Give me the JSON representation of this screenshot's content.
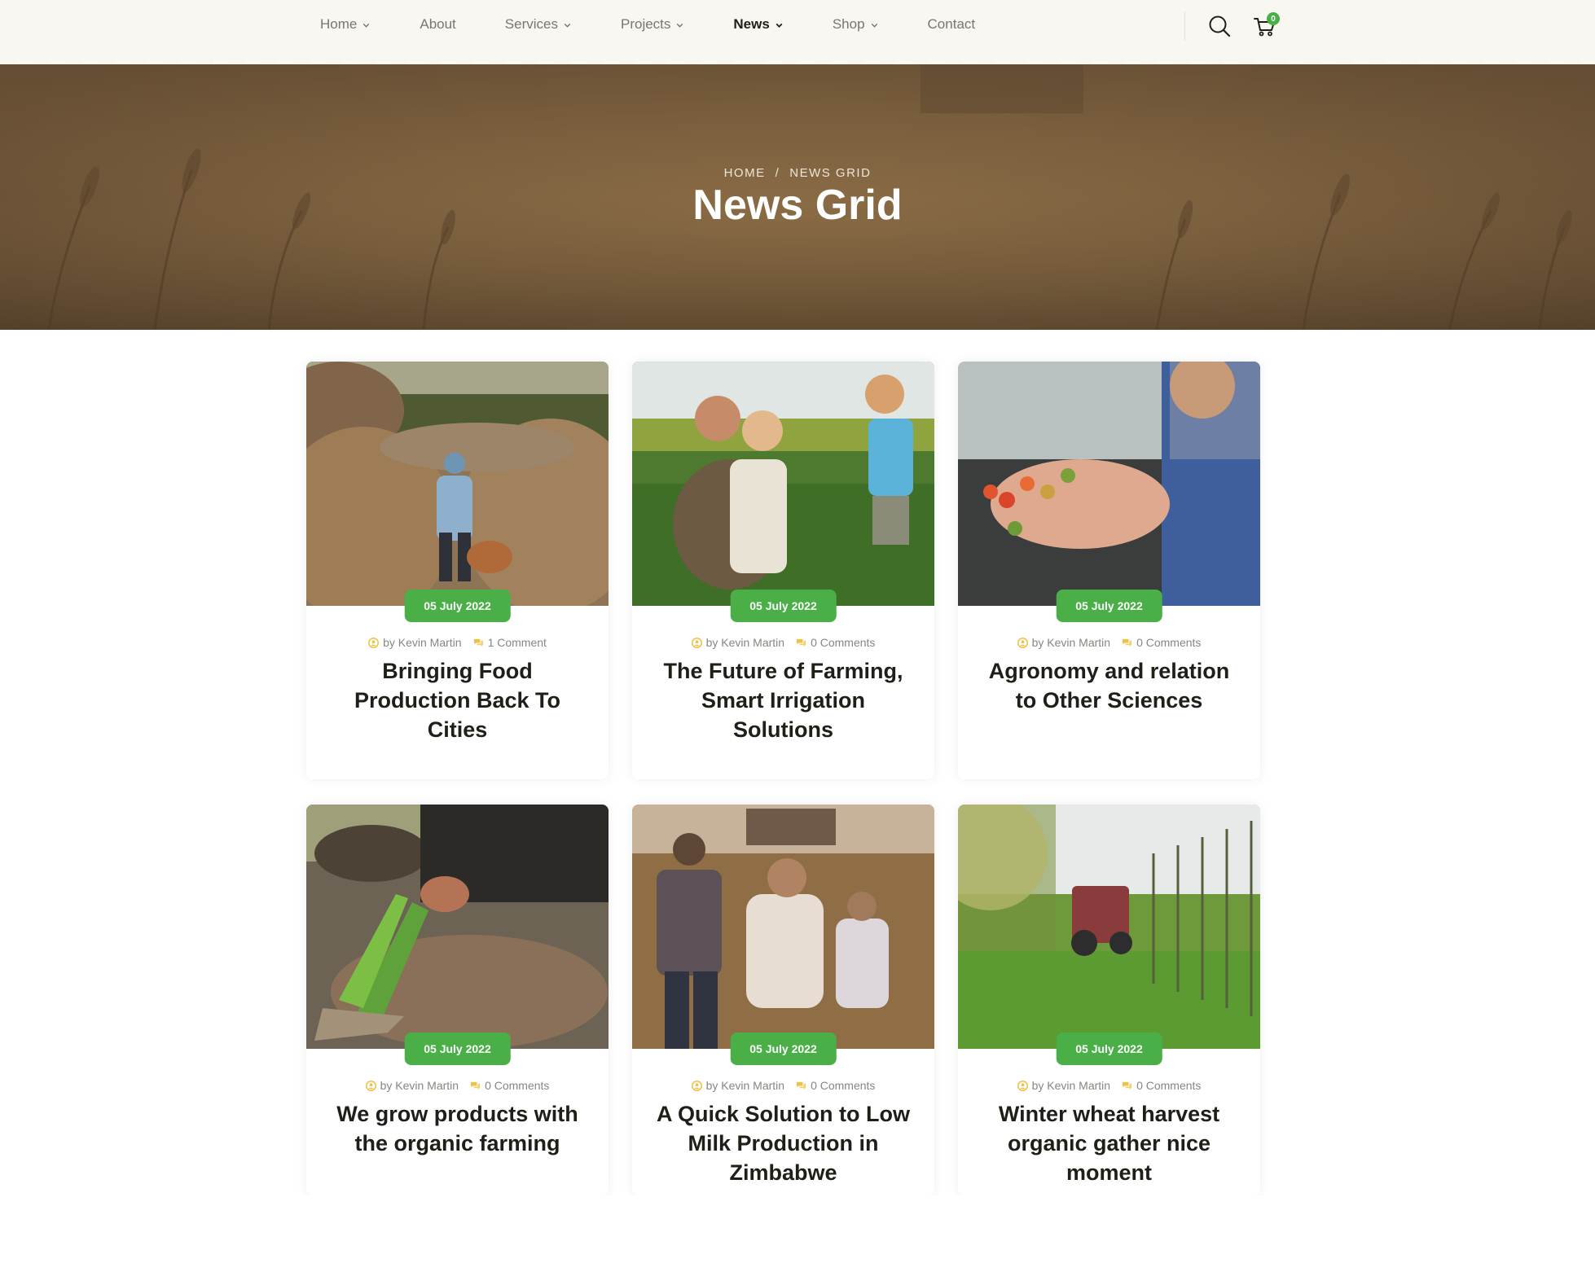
{
  "nav": {
    "items": [
      {
        "label": "Home",
        "dropdown": true,
        "active": false
      },
      {
        "label": "About",
        "dropdown": false,
        "active": false
      },
      {
        "label": "Services",
        "dropdown": true,
        "active": false
      },
      {
        "label": "Projects",
        "dropdown": true,
        "active": false
      },
      {
        "label": "News",
        "dropdown": true,
        "active": true
      },
      {
        "label": "Shop",
        "dropdown": true,
        "active": false
      },
      {
        "label": "Contact",
        "dropdown": false,
        "active": false
      }
    ],
    "search_icon": "search-icon",
    "cart_icon": "cart-icon",
    "cart_count": "0"
  },
  "hero": {
    "breadcrumb": [
      "Home",
      "/",
      "News Grid"
    ],
    "title": "News Grid"
  },
  "posts": [
    {
      "date": "05 July 2022",
      "author": "by Kevin Martin",
      "comments": "1 Comment",
      "title": "Bringing Food Production Back To Cities"
    },
    {
      "date": "05 July 2022",
      "author": "by Kevin Martin",
      "comments": "0 Comments",
      "title": "The Future of Farming, Smart Irrigation Solutions"
    },
    {
      "date": "05 July 2022",
      "author": "by Kevin Martin",
      "comments": "0 Comments",
      "title": "Agronomy and relation to Other Sciences"
    },
    {
      "date": "05 July 2022",
      "author": "by Kevin Martin",
      "comments": "0 Comments",
      "title": "We grow products with the organic farming"
    },
    {
      "date": "05 July 2022",
      "author": "by Kevin Martin",
      "comments": "0 Comments",
      "title": "A Quick Solution to Low Milk Production in Zimbabwe"
    },
    {
      "date": "05 July 2022",
      "author": "by Kevin Martin",
      "comments": "0 Comments",
      "title": "Winter wheat harvest organic gather nice moment"
    }
  ],
  "colors": {
    "accent": "#4baf47",
    "meta_icon": "#eec044",
    "title": "#1f1e17",
    "text_muted": "#878680",
    "header_bg": "#f8f7f2"
  }
}
